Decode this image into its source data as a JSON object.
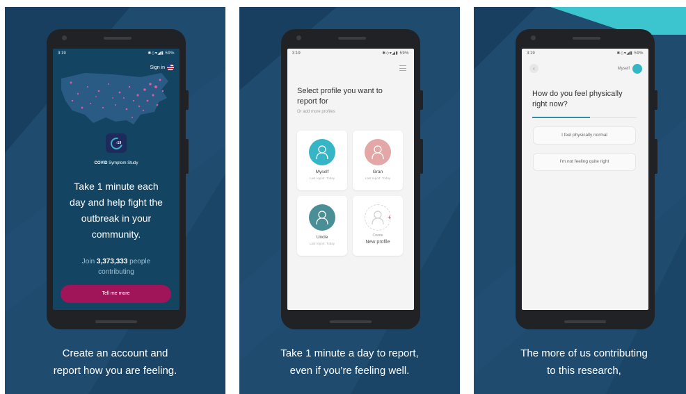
{
  "panels": [
    {
      "caption": [
        "Create an account and",
        "report how you are feeling."
      ],
      "status": {
        "time": "3:19",
        "icons": "✱◇▾◢▮ 59%"
      },
      "sign_in_label": "Sign in",
      "logo_text": "-19",
      "study_label_bold": "COVID",
      "study_label_rest": " Symptom Study",
      "headline": [
        "Take 1 minute each",
        "day and help fight the",
        "outbreak in your",
        "community."
      ],
      "join_prefix": "Join ",
      "join_count": "3,373,333",
      "join_suffix": " people",
      "join_line2": "contributing",
      "cta_label": "Tell me more"
    },
    {
      "caption": [
        "Take 1 minute a day to report,",
        "even if you’re feeling well."
      ],
      "status": {
        "time": "3:19",
        "icons": "✱◇▾◢▮ 59%"
      },
      "question": "Select profile you want to report for",
      "subtitle": "Or add more profiles",
      "profiles": [
        {
          "name": "Myself",
          "last": "Last report: Today",
          "color": "#35b5c6"
        },
        {
          "name": "Gran",
          "last": "Last report: Today",
          "color": "#e4a7a8"
        },
        {
          "name": "Uncle",
          "last": "Last report: Today",
          "color": "#4b8f96"
        }
      ],
      "new_profile": {
        "line1": "Create",
        "line2": "New profile",
        "plus": "+"
      }
    },
    {
      "caption": [
        "The more of us contributing",
        "to this research,"
      ],
      "status": {
        "time": "3:19",
        "icons": "✱◇▾◢▮ 59%"
      },
      "back_label": "‹",
      "profile_label": "Myself",
      "question": "How do you feel physically right now?",
      "progress": 0.55,
      "options": [
        "I feel physically normal",
        "I'm not feeling quite right"
      ]
    }
  ],
  "colors": {
    "panel_bg": "#1e4b6e",
    "panel_stripe": "#173b5a",
    "accent_teal": "#35b5c6",
    "cta_magenta": "#a0155a",
    "corner_cyan": "#3cc4cf"
  }
}
